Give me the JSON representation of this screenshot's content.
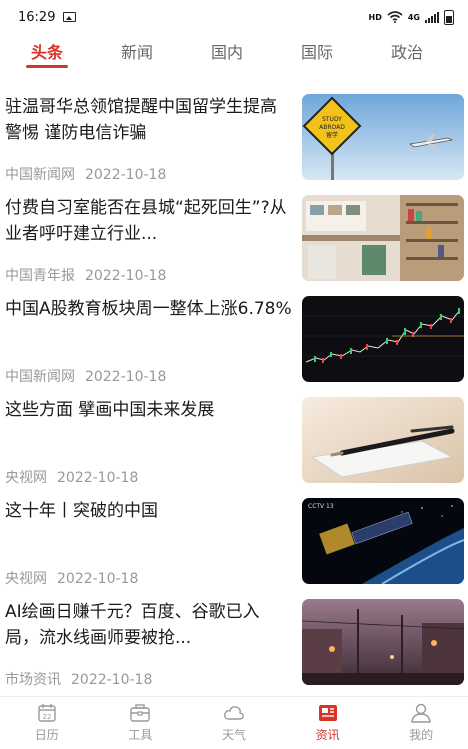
{
  "status": {
    "time": "16:29",
    "hd": "HD",
    "network": "4G"
  },
  "tabs": [
    {
      "label": "头条",
      "active": true
    },
    {
      "label": "新闻",
      "active": false
    },
    {
      "label": "国内",
      "active": false
    },
    {
      "label": "国际",
      "active": false
    },
    {
      "label": "政治",
      "active": false
    }
  ],
  "news": [
    {
      "title": "驻温哥华总领馆提醒中国留学生提高警惕 谨防电信诈骗",
      "source": "中国新闻网",
      "date": "2022-10-18",
      "sign_line1": "STUDY",
      "sign_line2": "ABROAD",
      "sign_line3": "留学"
    },
    {
      "title": "付费自习室能否在县城“起死回生”?从业者呼吁建立行业...",
      "source": "中国青年报",
      "date": "2022-10-18"
    },
    {
      "title": "中国A股教育板块周一整体上涨6.78%",
      "source": "中国新闻网",
      "date": "2022-10-18"
    },
    {
      "title": "这些方面 擘画中国未来发展",
      "source": "央视网",
      "date": "2022-10-18"
    },
    {
      "title": "这十年丨突破的中国",
      "source": "央视网",
      "date": "2022-10-18",
      "logo": "CCTV 13"
    },
    {
      "title": "AI绘画日赚千元？百度、谷歌已入局，流水线画师要被抢...",
      "source": "市场资讯",
      "date": "2022-10-18"
    }
  ],
  "bottom_nav": [
    {
      "label": "日历",
      "icon": "calendar-icon",
      "active": false
    },
    {
      "label": "工具",
      "icon": "toolbox-icon",
      "active": false
    },
    {
      "label": "天气",
      "icon": "cloud-icon",
      "active": false
    },
    {
      "label": "资讯",
      "icon": "news-icon",
      "active": true
    },
    {
      "label": "我的",
      "icon": "user-icon",
      "active": false
    }
  ],
  "colors": {
    "accent": "#d8342a",
    "muted": "#999999"
  }
}
